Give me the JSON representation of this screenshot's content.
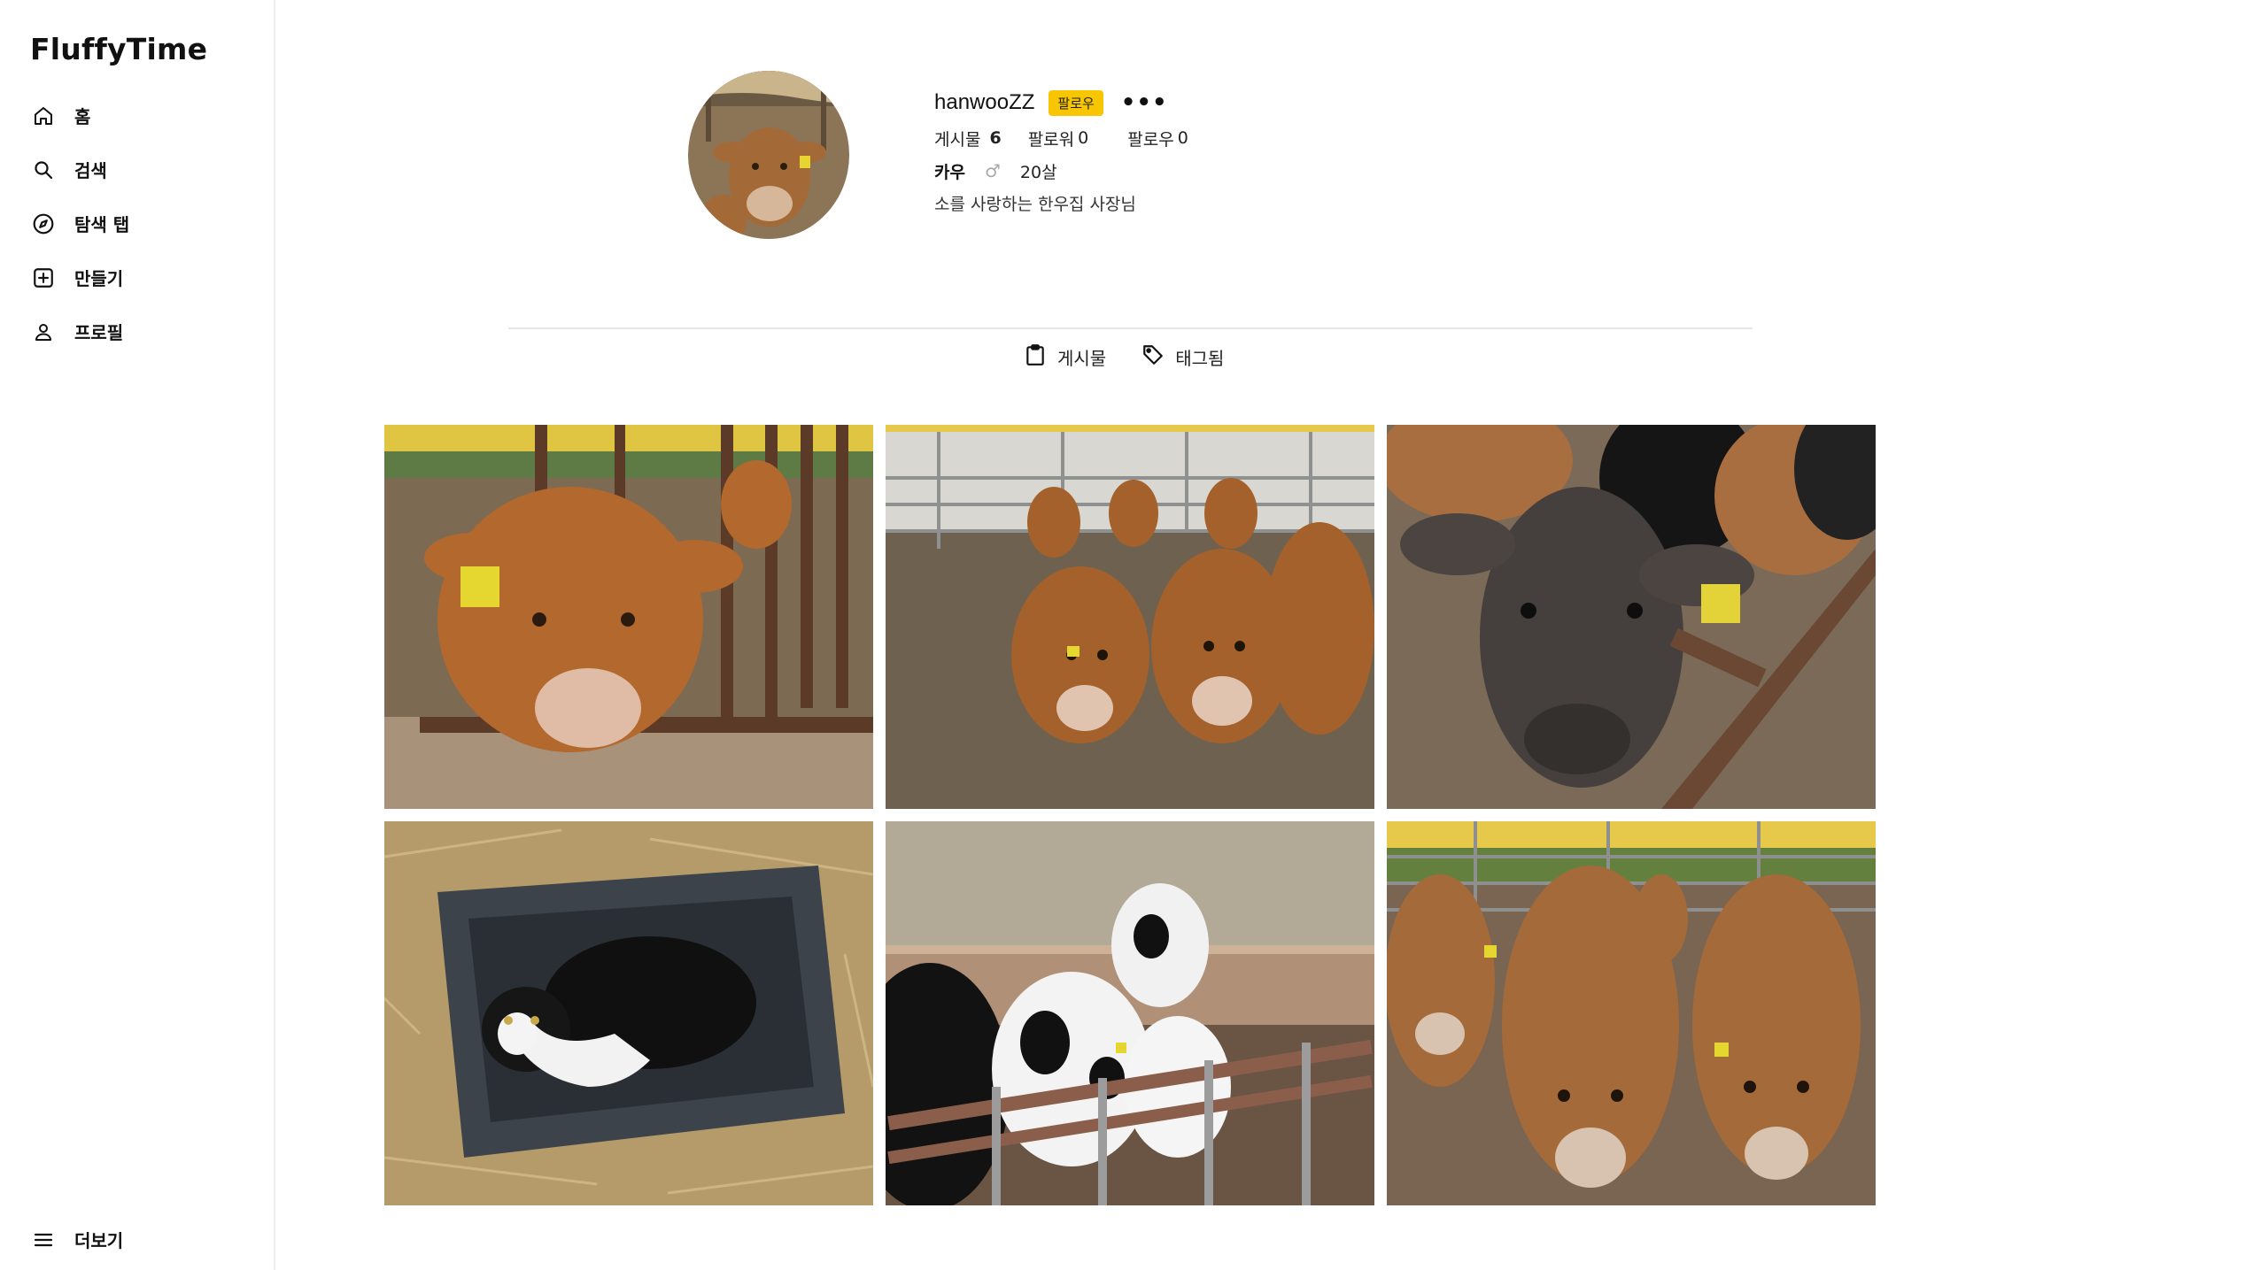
{
  "app": {
    "name": "FluffyTime"
  },
  "sidebar": {
    "items": [
      {
        "label": "홈",
        "icon": "home-icon"
      },
      {
        "label": "검색",
        "icon": "search-icon"
      },
      {
        "label": "탐색 탭",
        "icon": "compass-icon"
      },
      {
        "label": "만들기",
        "icon": "plus-square-icon"
      },
      {
        "label": "프로필",
        "icon": "user-icon"
      }
    ],
    "more": {
      "label": "더보기",
      "icon": "menu-icon"
    }
  },
  "profile": {
    "username": "hanwooZZ",
    "follow_label": "팔로우",
    "more_label": "•••",
    "stats": {
      "posts_label": "게시물",
      "posts_count": "6",
      "followers_label": "팔로워",
      "followers_count": "0",
      "following_label": "팔로우",
      "following_count": "0"
    },
    "pet_name": "카우",
    "gender_symbol": "♂",
    "age": "20살",
    "bio": "소를 사랑하는 한우집 사장님"
  },
  "tabs": [
    {
      "label": "게시물",
      "icon": "clipboard-icon",
      "active": true
    },
    {
      "label": "태그됨",
      "icon": "tag-icon",
      "active": false
    }
  ],
  "posts": [
    {
      "subject": "brown calf at fence with yellow ear tag"
    },
    {
      "subject": "four brown calves in barn pen"
    },
    {
      "subject": "dark cow close-up with ear tag"
    },
    {
      "subject": "black and white cat in gray trough on straw"
    },
    {
      "subject": "holstein calves behind metal fence"
    },
    {
      "subject": "jersey cows in pen"
    }
  ],
  "colors": {
    "accent_badge": "#f7c600",
    "divider": "#e5e5e5",
    "text": "#111111"
  }
}
